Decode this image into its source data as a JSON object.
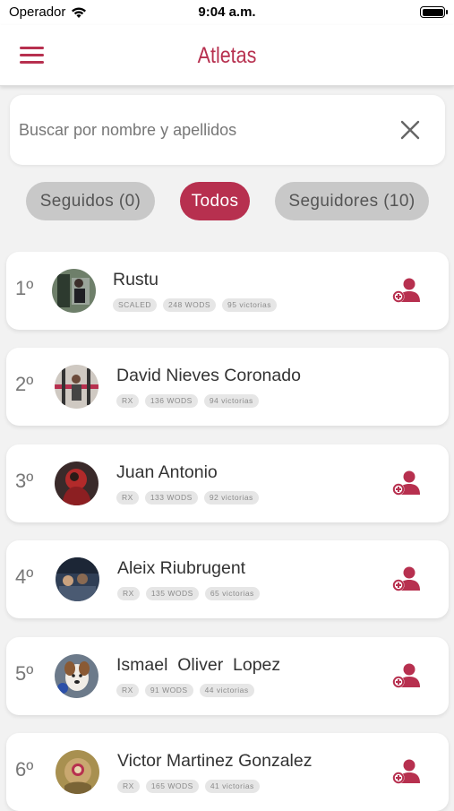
{
  "status_bar": {
    "carrier": "Operador",
    "time": "9:04 a.m."
  },
  "header": {
    "title": "Atletas",
    "menu_icon": "hamburger-menu-icon"
  },
  "search": {
    "placeholder": "Buscar por nombre y apellidos",
    "value": "",
    "clear_icon": "close-icon"
  },
  "filters": [
    {
      "label": "Seguidos (0)",
      "active": false
    },
    {
      "label": "Todos",
      "active": true
    },
    {
      "label": "Seguidores (10)",
      "active": false
    }
  ],
  "colors": {
    "accent": "#b7304f",
    "chip_inactive": "#c8c8c8",
    "background": "#f2f2f2"
  },
  "athletes": [
    {
      "rank": "1º",
      "name": "Rustu",
      "tags": [
        "SCALED",
        "248 WODS",
        "95 victorias"
      ],
      "follow_icon": "add-user-icon"
    },
    {
      "rank": "2º",
      "name": "David Nieves Coronado",
      "tags": [
        "RX",
        "136 WODS",
        "94 victorias"
      ]
    },
    {
      "rank": "3º",
      "name": "Juan Antonio",
      "tags": [
        "RX",
        "133 WODS",
        "92 victorias"
      ],
      "follow_icon": "add-user-icon"
    },
    {
      "rank": "4º",
      "name": "Aleix Riubrugent",
      "tags": [
        "RX",
        "135 WODS",
        "65 victorias"
      ],
      "follow_icon": "add-user-icon"
    },
    {
      "rank": "5º",
      "name": "Ismael  Oliver  Lopez",
      "tags": [
        "RX",
        "91 WODS",
        "44 victorias"
      ],
      "follow_icon": "add-user-icon"
    },
    {
      "rank": "6º",
      "name": "Victor Martinez Gonzalez",
      "tags": [
        "RX",
        "165 WODS",
        "41 victorias"
      ],
      "follow_icon": "add-user-icon"
    }
  ]
}
